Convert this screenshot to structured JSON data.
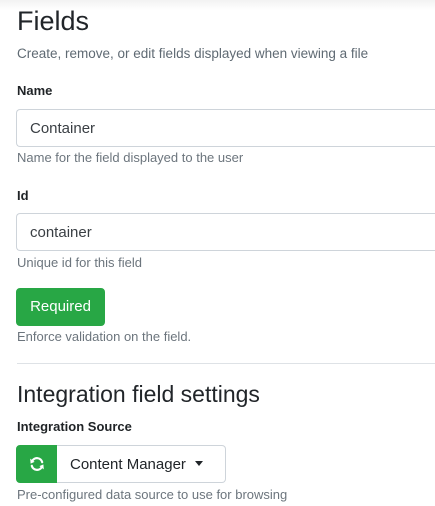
{
  "header": {
    "title": "Fields",
    "subtitle": "Create, remove, or edit fields displayed when viewing a file"
  },
  "name_field": {
    "label": "Name",
    "value": "Container",
    "help": "Name for the field displayed to the user"
  },
  "id_field": {
    "label": "Id",
    "value": "container",
    "help": "Unique id for this field"
  },
  "required": {
    "button_label": "Required",
    "help": "Enforce validation on the field."
  },
  "integration": {
    "section_title": "Integration field settings",
    "source_label": "Integration Source",
    "refresh_icon": "refresh-icon",
    "selected_source": "Content Manager",
    "help": "Pre-configured data source to use for browsing"
  },
  "colors": {
    "success": "#28a745",
    "border": "#ced4da",
    "muted": "#6c757d"
  }
}
